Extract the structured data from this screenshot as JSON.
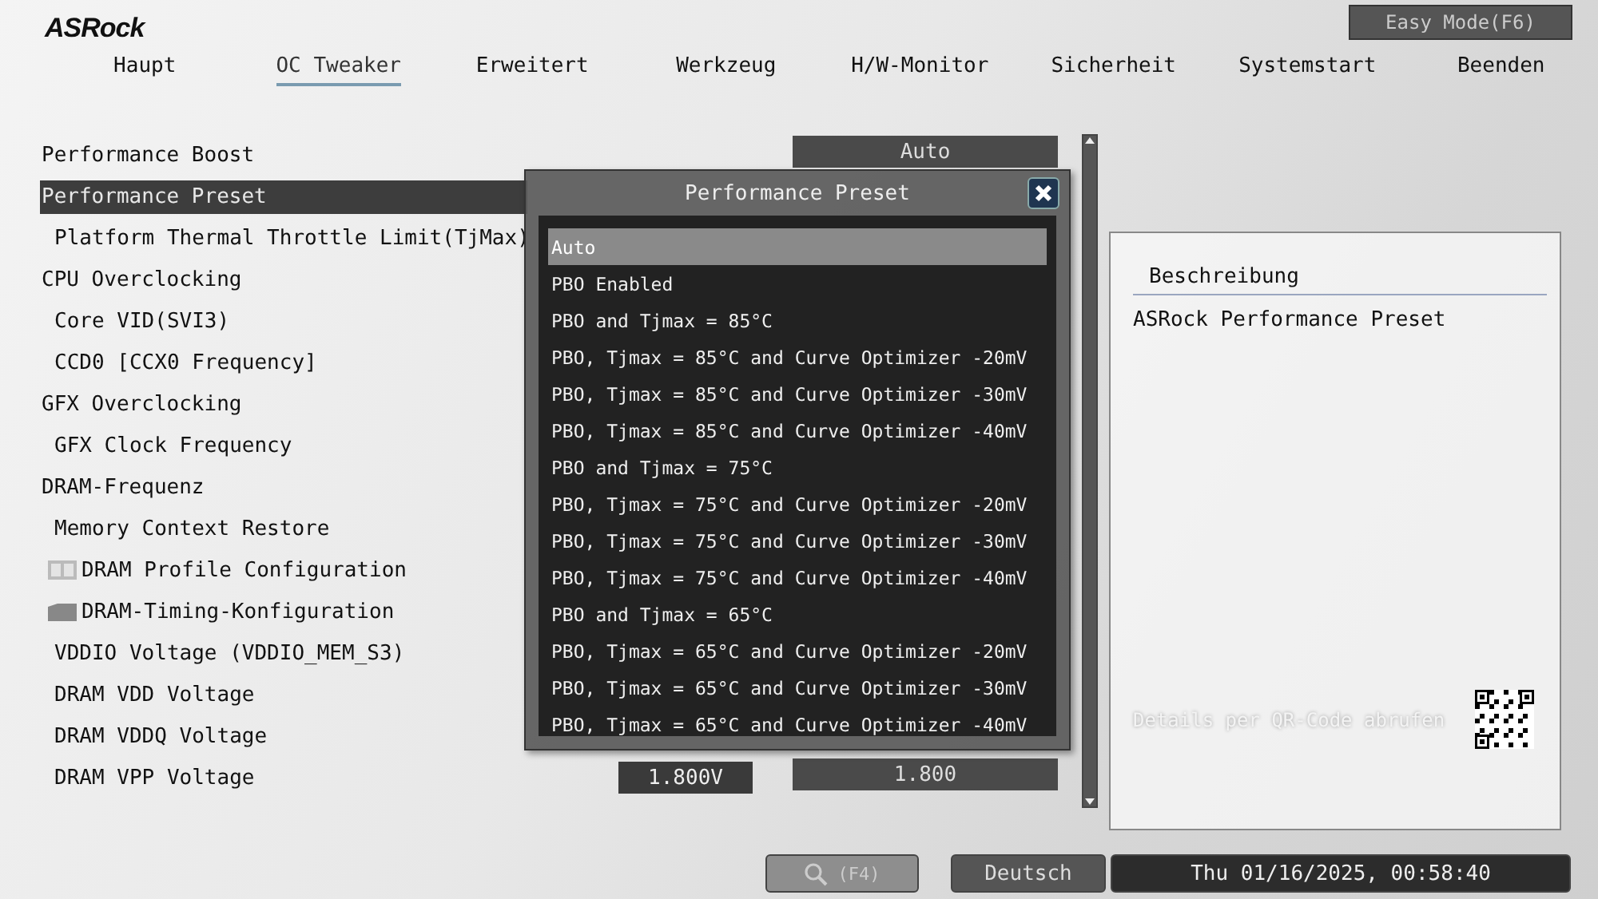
{
  "brand": "ASRock",
  "easy_mode": "Easy Mode(F6)",
  "tabs": [
    {
      "label": "Haupt",
      "selected": false
    },
    {
      "label": "OC Tweaker",
      "selected": true
    },
    {
      "label": "Erweitert",
      "selected": false
    },
    {
      "label": "Werkzeug",
      "selected": false
    },
    {
      "label": "H/W-Monitor",
      "selected": false
    },
    {
      "label": "Sicherheit",
      "selected": false
    },
    {
      "label": "Systemstart",
      "selected": false
    },
    {
      "label": "Beenden",
      "selected": false
    }
  ],
  "menu": [
    {
      "label": "Performance Boost",
      "kind": "setting",
      "selected": false,
      "value": "Auto"
    },
    {
      "label": "Performance Preset",
      "kind": "setting",
      "selected": true,
      "children": [
        {
          "label": "Platform Thermal Throttle Limit(TjMax)",
          "kind": "setting",
          "selected": false
        }
      ]
    },
    {
      "label": "CPU Overclocking",
      "kind": "setting",
      "selected": false,
      "children": [
        {
          "label": "Core VID(SVI3)",
          "kind": "setting",
          "selected": false
        },
        {
          "label": "CCD0 [CCX0 Frequency]",
          "kind": "setting",
          "selected": false
        }
      ]
    },
    {
      "label": "GFX Overclocking",
      "kind": "setting",
      "selected": false,
      "children": [
        {
          "label": "GFX Clock Frequency",
          "kind": "setting",
          "selected": false
        }
      ]
    },
    {
      "label": "DRAM-Frequenz",
      "kind": "setting",
      "selected": false,
      "children": [
        {
          "label": "Memory Context Restore",
          "kind": "setting",
          "selected": false
        },
        {
          "label": "DRAM Profile Configuration",
          "kind": "profile",
          "selected": false
        },
        {
          "label": "DRAM-Timing-Konfiguration",
          "kind": "folder",
          "selected": false
        },
        {
          "label": "VDDIO Voltage (VDDIO_MEM_S3)",
          "kind": "setting",
          "selected": false
        },
        {
          "label": "DRAM VDD Voltage",
          "kind": "setting",
          "selected": false
        },
        {
          "label": "DRAM VDDQ Voltage",
          "kind": "setting",
          "selected": false
        },
        {
          "label": "DRAM VPP Voltage",
          "kind": "setting",
          "selected": false,
          "reading": "1.800V",
          "value": "1.800"
        }
      ]
    }
  ],
  "dialog": {
    "title": "Performance Preset",
    "options": [
      {
        "label": "Auto",
        "selected": true
      },
      {
        "label": "PBO Enabled",
        "selected": false
      },
      {
        "label": "PBO and Tjmax = 85°C",
        "selected": false
      },
      {
        "label": "PBO, Tjmax = 85°C and Curve Optimizer -20mV",
        "selected": false
      },
      {
        "label": "PBO, Tjmax = 85°C and Curve Optimizer -30mV",
        "selected": false
      },
      {
        "label": "PBO, Tjmax = 85°C and Curve Optimizer -40mV",
        "selected": false
      },
      {
        "label": "PBO and Tjmax = 75°C",
        "selected": false
      },
      {
        "label": "PBO, Tjmax = 75°C and Curve Optimizer -20mV",
        "selected": false
      },
      {
        "label": "PBO, Tjmax = 75°C and Curve Optimizer -30mV",
        "selected": false
      },
      {
        "label": "PBO, Tjmax = 75°C and Curve Optimizer -40mV",
        "selected": false
      },
      {
        "label": "PBO and Tjmax = 65°C",
        "selected": false
      },
      {
        "label": "PBO, Tjmax = 65°C and Curve Optimizer -20mV",
        "selected": false
      },
      {
        "label": "PBO, Tjmax = 65°C and Curve Optimizer -30mV",
        "selected": false
      },
      {
        "label": "PBO, Tjmax = 65°C and Curve Optimizer -40mV",
        "selected": false
      }
    ]
  },
  "help": {
    "heading": "Beschreibung",
    "text": "ASRock Performance Preset",
    "qr_hint": "Details per QR-Code abrufen"
  },
  "bottom_bar": {
    "search_key": "(F4)",
    "language": "Deutsch",
    "datetime": "Thu 01/16/2025, 00:58:40"
  }
}
